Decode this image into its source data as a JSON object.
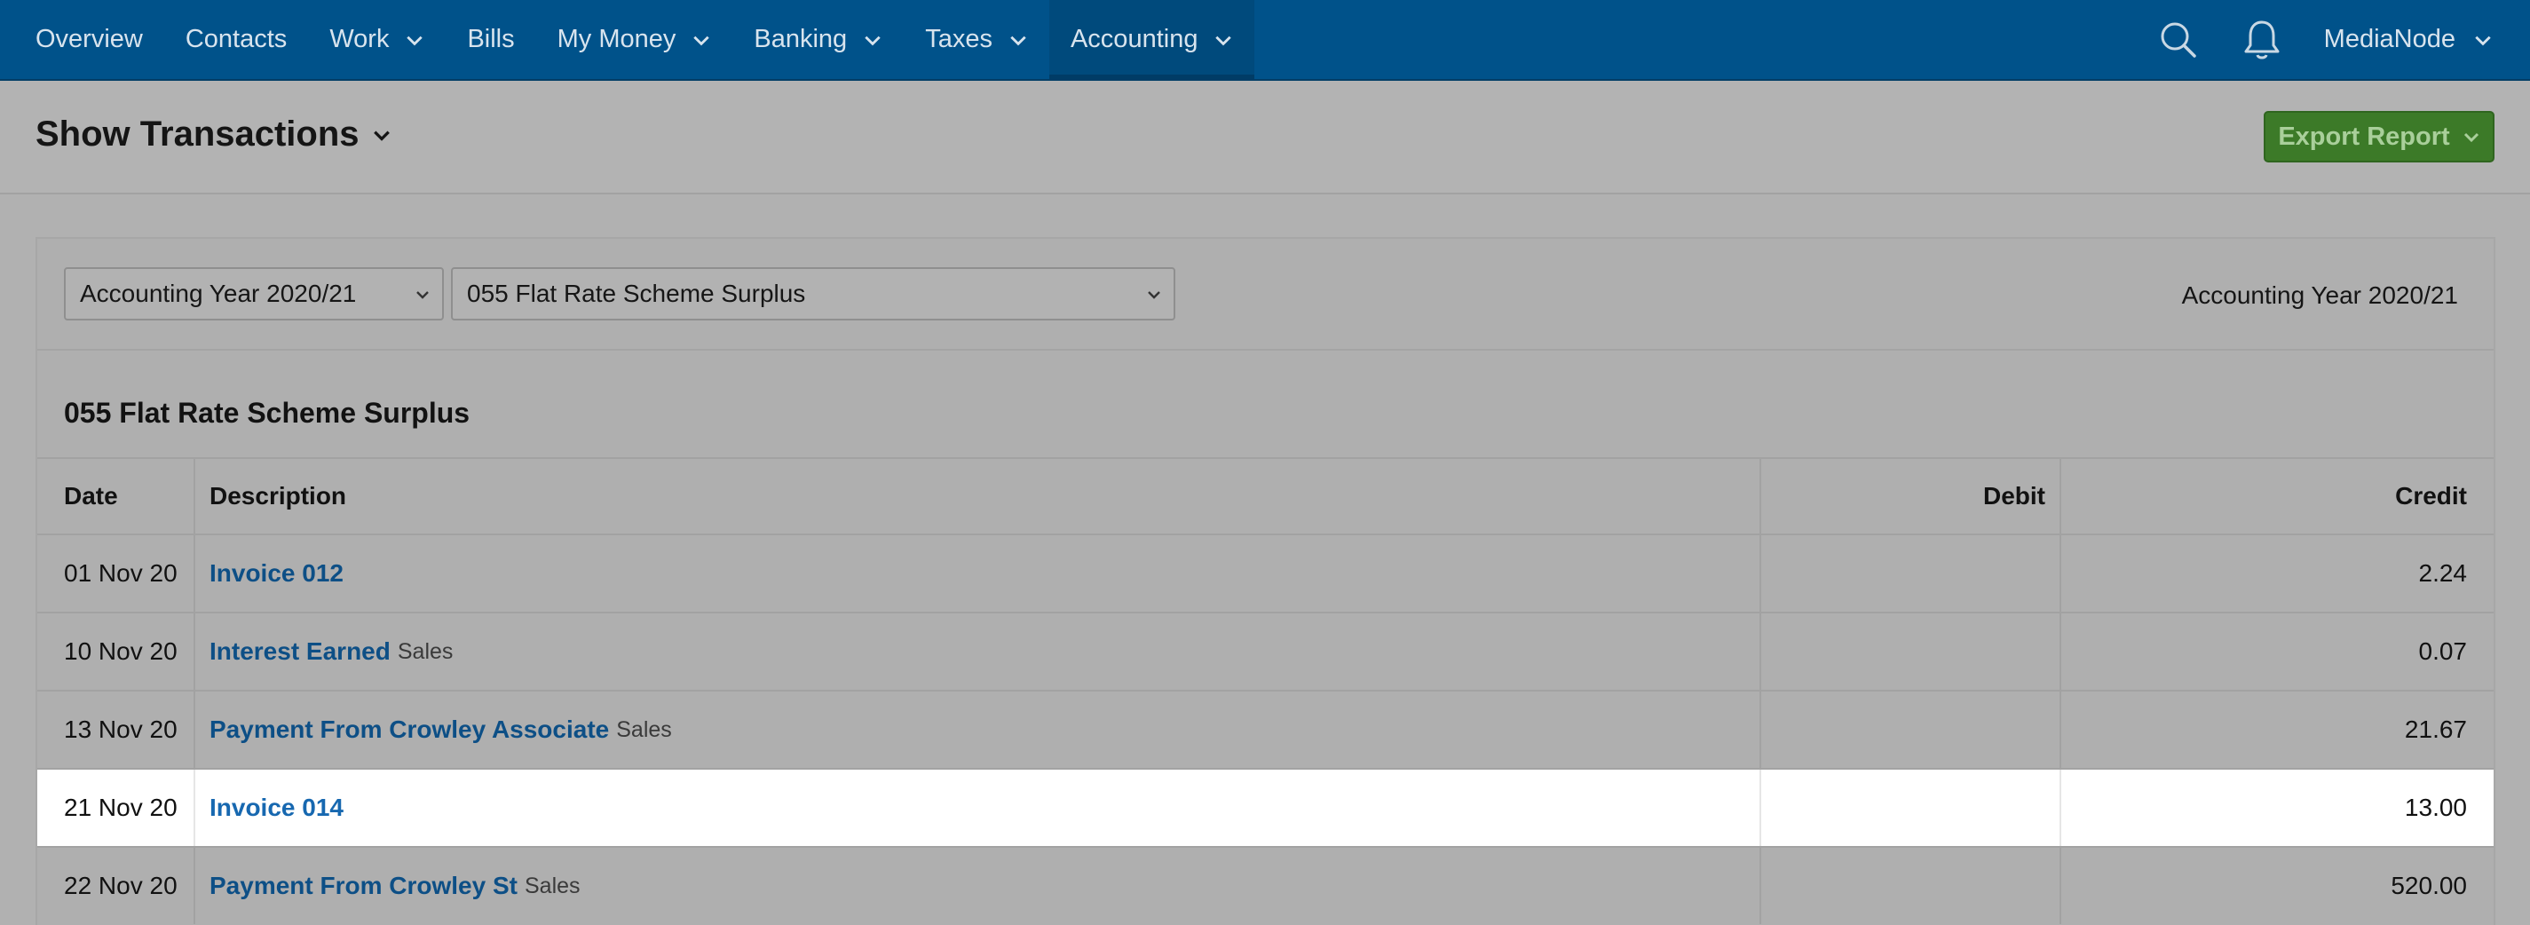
{
  "nav": {
    "items": [
      {
        "label": "Overview",
        "dropdown": false
      },
      {
        "label": "Contacts",
        "dropdown": false
      },
      {
        "label": "Work",
        "dropdown": true
      },
      {
        "label": "Bills",
        "dropdown": false
      },
      {
        "label": "My Money",
        "dropdown": true
      },
      {
        "label": "Banking",
        "dropdown": true
      },
      {
        "label": "Taxes",
        "dropdown": true
      },
      {
        "label": "Accounting",
        "dropdown": true,
        "active": true
      }
    ],
    "search_icon": "search-icon",
    "notifications_icon": "bell-icon",
    "account_name": "MediaNode"
  },
  "header": {
    "title": "Show Transactions",
    "export_label": "Export Report"
  },
  "filters": {
    "year_select": "Accounting Year 2020/21",
    "account_select": "055 Flat Rate Scheme Surplus",
    "period_label": "Accounting Year 2020/21"
  },
  "ledger": {
    "title": "055 Flat Rate Scheme Surplus",
    "columns": {
      "date": "Date",
      "description": "Description",
      "debit": "Debit",
      "credit": "Credit"
    },
    "rows": [
      {
        "date": "01 Nov 20",
        "description": "Invoice 012",
        "tag": "",
        "debit": "",
        "credit": "2.24"
      },
      {
        "date": "10 Nov 20",
        "description": "Interest Earned",
        "tag": "Sales",
        "debit": "",
        "credit": "0.07"
      },
      {
        "date": "13 Nov 20",
        "description": "Payment From Crowley Associate",
        "tag": "Sales",
        "debit": "",
        "credit": "21.67"
      },
      {
        "date": "21 Nov 20",
        "description": "Invoice 014",
        "tag": "",
        "debit": "",
        "credit": "13.00",
        "highlighted": true
      },
      {
        "date": "22 Nov 20",
        "description": "Payment From Crowley St",
        "tag": "Sales",
        "debit": "",
        "credit": "520.00"
      }
    ]
  },
  "colors": {
    "nav_bg": "#00528a",
    "export_button": "#3c7a28",
    "link": "#0d4f86",
    "highlight_row": "#ffffff"
  }
}
